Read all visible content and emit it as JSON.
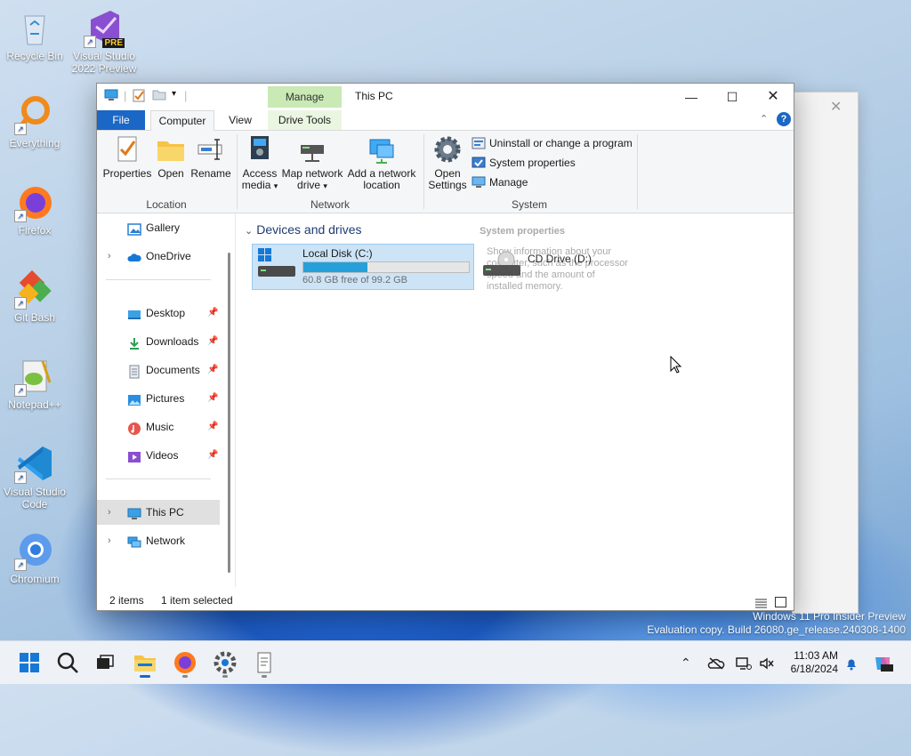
{
  "desktop": {
    "icons": [
      {
        "label": "Recycle Bin",
        "icon": "recycle-bin-icon"
      },
      {
        "label": "Visual Studio 2022 Preview",
        "icon": "visual-studio-icon",
        "badge": "PRE"
      },
      {
        "label": "Everything",
        "icon": "everything-search-icon"
      },
      {
        "label": "Firefox",
        "icon": "firefox-icon"
      },
      {
        "label": "Git Bash",
        "icon": "git-bash-icon"
      },
      {
        "label": "Notepad++",
        "icon": "notepadpp-icon"
      },
      {
        "label": "Visual Studio Code",
        "icon": "vscode-icon"
      },
      {
        "label": "Chromium",
        "icon": "chromium-icon"
      }
    ],
    "watermark_line1": "Windows 11 Pro Insider Preview",
    "watermark_line2": "Evaluation copy. Build 26080.ge_release.240308-1400"
  },
  "explorer": {
    "title": "This PC",
    "context_tab_group": "Manage",
    "tabs": [
      "File",
      "Computer",
      "View",
      "Drive Tools"
    ],
    "selected_tab": "Computer",
    "ribbon": {
      "location": {
        "group": "Location",
        "properties": "Properties",
        "open": "Open",
        "rename": "Rename"
      },
      "network": {
        "group": "Network",
        "access_media": "Access media",
        "map_drive": "Map network drive",
        "add_location": "Add a network location"
      },
      "system": {
        "group": "System",
        "open_settings": "Open Settings",
        "uninstall": "Uninstall or change a program",
        "system_properties": "System properties",
        "manage": "Manage"
      }
    },
    "nav": {
      "gallery": "Gallery",
      "onedrive": "OneDrive",
      "desktop": "Desktop",
      "downloads": "Downloads",
      "documents": "Documents",
      "pictures": "Pictures",
      "music": "Music",
      "videos": "Videos",
      "this_pc": "This PC",
      "network": "Network"
    },
    "section_header": "Devices and drives",
    "drives": [
      {
        "name": "Local Disk (C:)",
        "free_text": "60.8 GB free of 99.2 GB",
        "used_fraction": 0.387
      },
      {
        "name": "CD Drive (D:)"
      }
    ],
    "tooltip": {
      "title": "System properties",
      "body": "Show information about your computer, such as the processor speed and the amount of installed memory."
    },
    "status": {
      "items": "2 items",
      "selected": "1 item selected"
    }
  },
  "taskbar": {
    "time": "11:03 AM",
    "date": "6/18/2024"
  },
  "colors": {
    "accent": "#1b67c5",
    "manage_tab": "#c9e9b5",
    "drive_bar": "#26a0da"
  }
}
